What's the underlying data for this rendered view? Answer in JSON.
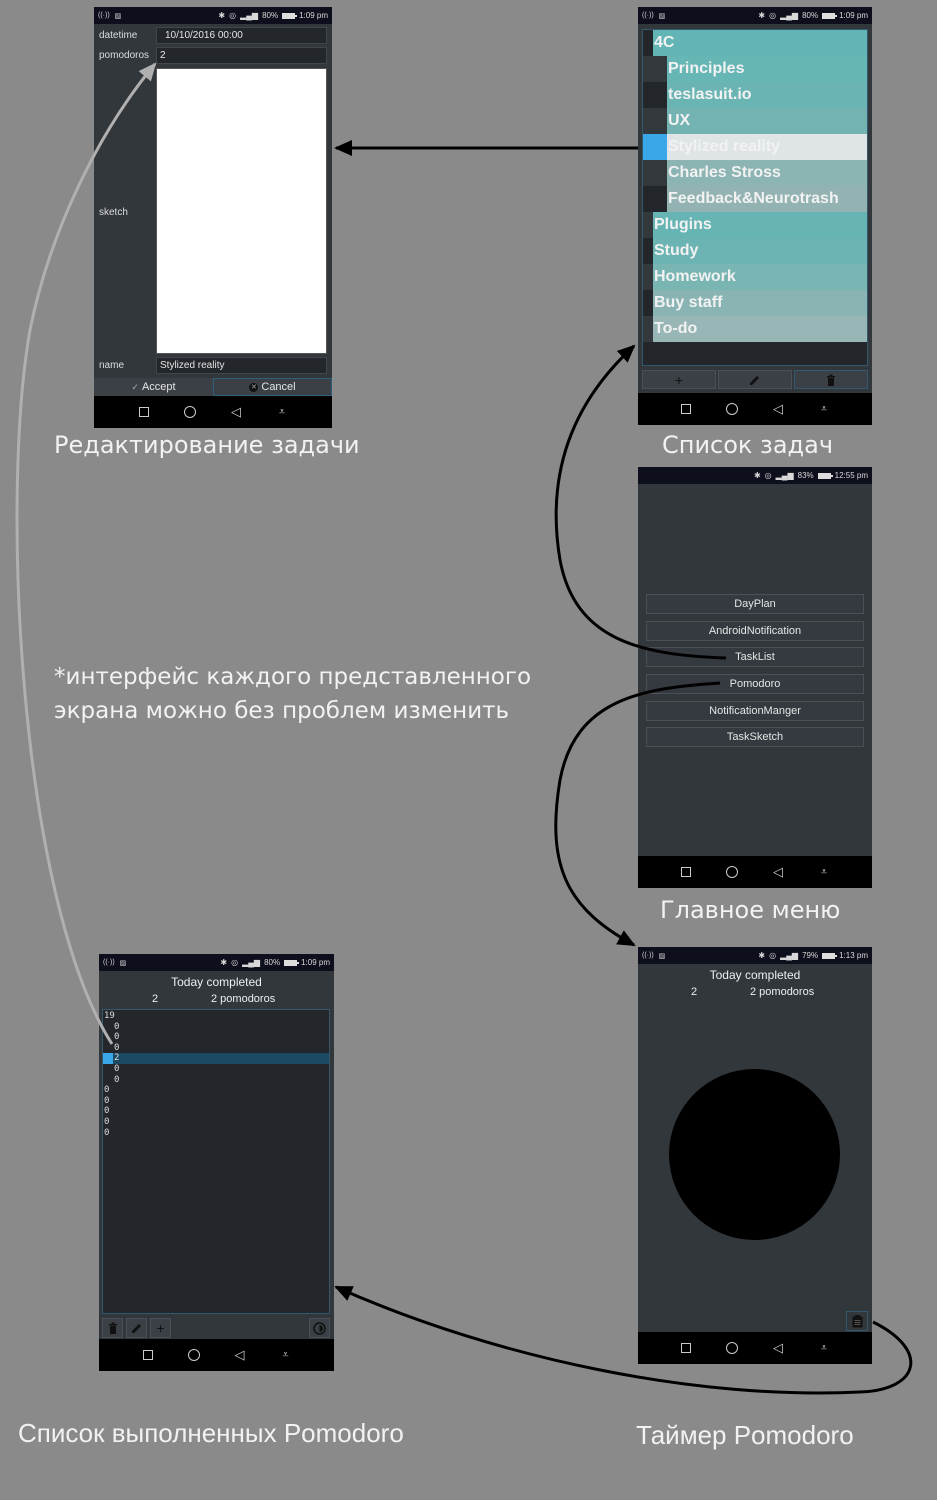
{
  "note": "*интерфейс каждого представленного\nэкрана можно без проблем изменить",
  "note_lines": [
    "*интерфейс каждого представленного",
    "экрана можно без проблем изменить"
  ],
  "captions": {
    "edit": "Редактирование задачи",
    "tasks": "Список задач",
    "menu": "Главное меню",
    "completed": "Список выполненных Pomodoro",
    "timer": "Таймер Pomodoro"
  },
  "edit_screen": {
    "status": {
      "battery": "80%",
      "time": "1:09 pm"
    },
    "fields": {
      "datetime_label": "datetime",
      "datetime_value": "10/10/2016 00:00",
      "pomodoros_label": "pomodoros",
      "pomodoros_value": "2",
      "sketch_label": "sketch",
      "name_label": "name",
      "name_value": "Stylized reality"
    },
    "accept_label": "Accept",
    "cancel_label": "Cancel"
  },
  "tasks_screen": {
    "status": {
      "battery": "80%",
      "time": "1:09 pm"
    },
    "items": [
      {
        "label": "4C",
        "level": 0,
        "color": "#63b4b4",
        "indicator": "#23272b"
      },
      {
        "label": "Principles",
        "level": 1,
        "color": "#66b6b5",
        "indicator": "#33383d"
      },
      {
        "label": "teslasuit.io",
        "level": 1,
        "color": "#6ab4b3",
        "indicator": "#23272b"
      },
      {
        "label": "UX",
        "level": 1,
        "color": "#73b4b2",
        "indicator": "#33383d"
      },
      {
        "label": "Stylized reality",
        "level": 1,
        "color": "#dfe5e6",
        "indicator": "#3aa8e8",
        "selected": true
      },
      {
        "label": "Charles Stross",
        "level": 1,
        "color": "#8cb4b3",
        "indicator": "#33383d"
      },
      {
        "label": "Feedback&Neurotrash",
        "level": 1,
        "color": "#93b3b3",
        "indicator": "#23272b"
      },
      {
        "label": "Plugins",
        "level": 0,
        "color": "#66b4b3",
        "indicator": "#33383d"
      },
      {
        "label": "Study",
        "level": 0,
        "color": "#6cb4b3",
        "indicator": "#23272b"
      },
      {
        "label": "Homework",
        "level": 0,
        "color": "#79b5b3",
        "indicator": "#33383d"
      },
      {
        "label": "Buy staff",
        "level": 0,
        "color": "#8ab4b4",
        "indicator": "#23272b"
      },
      {
        "label": "To-do",
        "level": 0,
        "color": "#99b6b6",
        "indicator": "#33383d"
      }
    ],
    "buttons": {
      "add": "+",
      "edit": "✎",
      "delete": "🗑"
    }
  },
  "menu_screen": {
    "status": {
      "battery": "83%",
      "time": "12:55 pm"
    },
    "buttons": [
      "DayPlan",
      "AndroidNotification",
      "TaskList",
      "Pomodoro",
      "NotificationManger",
      "TaskSketch"
    ]
  },
  "timer_screen": {
    "status": {
      "battery": "79%",
      "time": "1:13 pm"
    },
    "title": "Today completed",
    "count": "2",
    "pomodoros": "2 pomodoros"
  },
  "completed_screen": {
    "status": {
      "battery": "80%",
      "time": "1:09 pm"
    },
    "title": "Today completed",
    "count": "2",
    "pomodoros": "2 pomodoros",
    "values": [
      {
        "v": "19",
        "indent": 0
      },
      {
        "v": "0",
        "indent": 1
      },
      {
        "v": "0",
        "indent": 1
      },
      {
        "v": "0",
        "indent": 1
      },
      {
        "v": "2",
        "indent": 1,
        "selected": true
      },
      {
        "v": "0",
        "indent": 1
      },
      {
        "v": "0",
        "indent": 1
      },
      {
        "v": "0",
        "indent": 0
      },
      {
        "v": "0",
        "indent": 0
      },
      {
        "v": "0",
        "indent": 0
      },
      {
        "v": "0",
        "indent": 0
      },
      {
        "v": "0",
        "indent": 0
      }
    ]
  },
  "colors": {
    "background": "#8a8a8a",
    "screen": "#32373c",
    "accent": "#3aa8e8",
    "selection": "#1b4a62"
  }
}
